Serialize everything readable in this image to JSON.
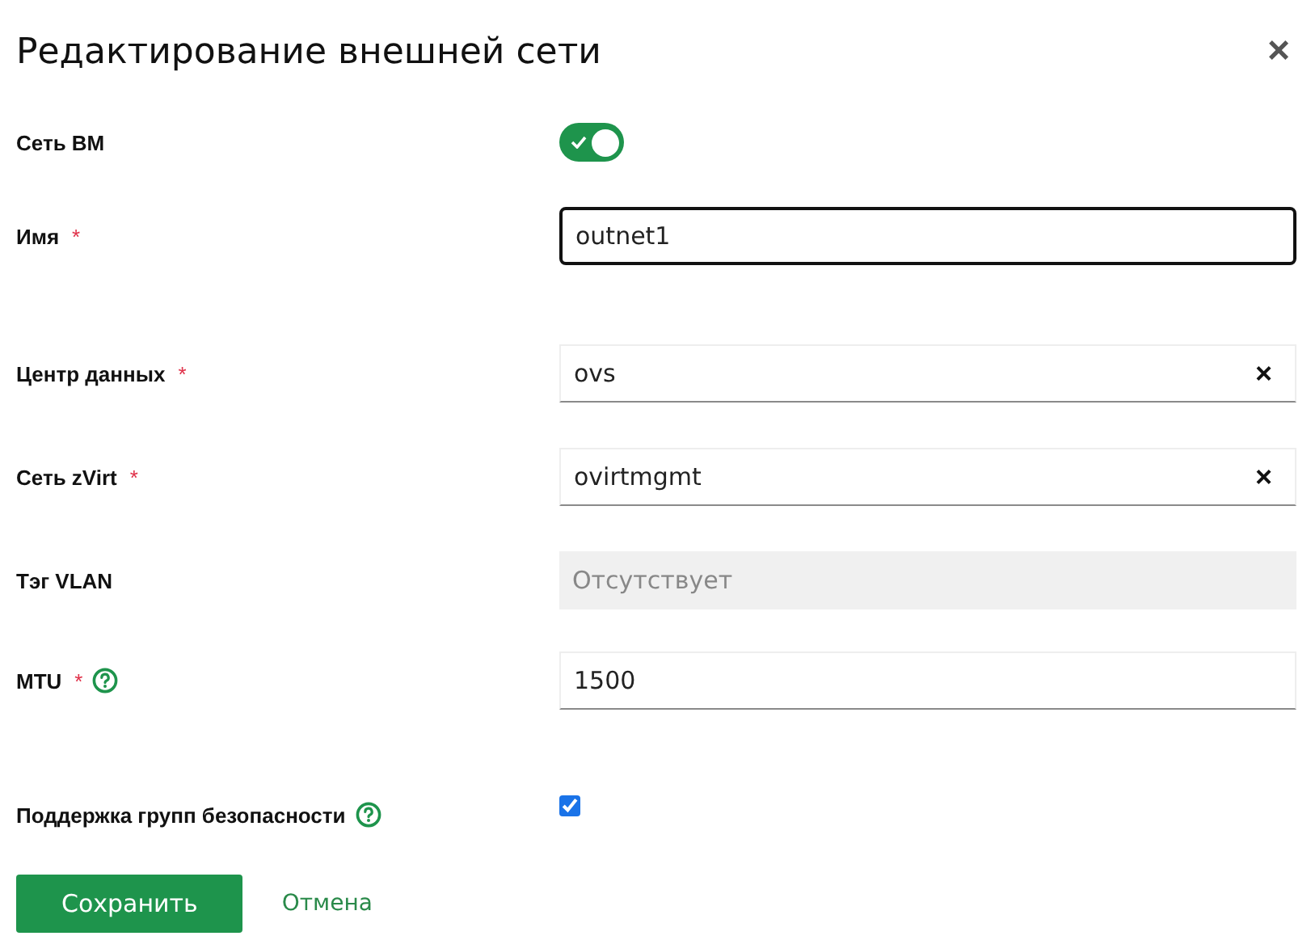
{
  "dialog": {
    "title": "Редактирование внешней сети",
    "close": "×"
  },
  "fields": [
    {
      "kind": "toggle",
      "label": "Сеть ВМ",
      "on": true
    },
    {
      "kind": "text",
      "label": "Имя",
      "required_mark": "*",
      "value": "outnet1",
      "focused": true
    },
    {
      "kind": "select",
      "label": "Центр данных",
      "required_mark": "*",
      "value": "ovs",
      "clear": "×"
    },
    {
      "kind": "select",
      "label": "Сеть zVirt",
      "required_mark": "*",
      "value": "ovirtmgmt",
      "clear": "×"
    },
    {
      "kind": "disabled",
      "label": "Тэг VLAN",
      "placeholder": "Отсутствует"
    },
    {
      "kind": "text",
      "label": "MTU",
      "required_mark": "*",
      "help": true,
      "value": "1500",
      "focused": false
    },
    {
      "kind": "checkbox",
      "label": "Поддержка групп безопасности",
      "help": true,
      "checked": true
    }
  ],
  "buttons": [
    {
      "kind": "primary",
      "label": "Сохранить"
    },
    {
      "kind": "link",
      "label": "Отмена"
    }
  ]
}
